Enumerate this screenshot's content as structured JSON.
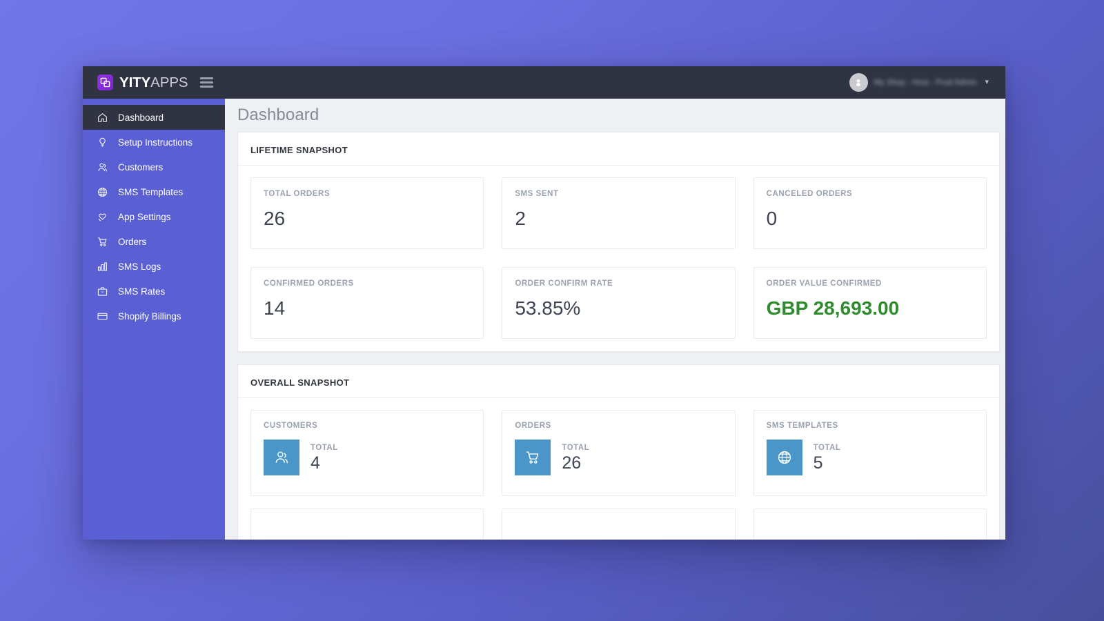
{
  "topbar": {
    "brand_bold": "YITY",
    "brand_light": "APPS",
    "brand_logo_icon": "overlapping-squares-icon",
    "menu_icon": "hamburger-menu-icon",
    "avatar_icon": "user-avatar-icon",
    "user_name": "My Shop - Host - Prod Admin",
    "caret_icon": "chevron-down-icon"
  },
  "sidebar": {
    "items": [
      {
        "label": "Dashboard",
        "icon": "home-icon",
        "active": true
      },
      {
        "label": "Setup Instructions",
        "icon": "lightbulb-icon",
        "active": false
      },
      {
        "label": "Customers",
        "icon": "users-icon",
        "active": false
      },
      {
        "label": "SMS Templates",
        "icon": "globe-icon",
        "active": false
      },
      {
        "label": "App Settings",
        "icon": "heart-hand-icon",
        "active": false
      },
      {
        "label": "Orders",
        "icon": "cart-icon",
        "active": false
      },
      {
        "label": "SMS Logs",
        "icon": "bar-chart-icon",
        "active": false
      },
      {
        "label": "SMS Rates",
        "icon": "briefcase-icon",
        "active": false
      },
      {
        "label": "Shopify Billings",
        "icon": "credit-card-icon",
        "active": false
      }
    ]
  },
  "page": {
    "title": "Dashboard"
  },
  "lifetime_snapshot": {
    "title": "LIFETIME SNAPSHOT",
    "cards": [
      {
        "label": "TOTAL ORDERS",
        "value": "26",
        "money": false
      },
      {
        "label": "SMS SENT",
        "value": "2",
        "money": false
      },
      {
        "label": "CANCELED ORDERS",
        "value": "0",
        "money": false
      },
      {
        "label": "CONFIRMED ORDERS",
        "value": "14",
        "money": false
      },
      {
        "label": "ORDER CONFIRM RATE",
        "value": "53.85%",
        "money": false
      },
      {
        "label": "ORDER VALUE CONFIRMED",
        "value": "GBP 28,693.00",
        "money": true
      }
    ]
  },
  "overall_snapshot": {
    "title": "OVERALL SNAPSHOT",
    "cards": [
      {
        "label": "CUSTOMERS",
        "total_label": "TOTAL",
        "value": "4",
        "icon": "users-icon"
      },
      {
        "label": "ORDERS",
        "total_label": "TOTAL",
        "value": "26",
        "icon": "cart-icon"
      },
      {
        "label": "SMS TEMPLATES",
        "total_label": "TOTAL",
        "value": "5",
        "icon": "globe-icon"
      }
    ]
  },
  "colors": {
    "sidebar": "#5a5fd4",
    "topbar": "#2f3342",
    "accent_tile": "#4a96c8",
    "money_green": "#2e8b2e",
    "page_bg": "#eef0f4",
    "desktop_bg": "#6b6fe0"
  }
}
